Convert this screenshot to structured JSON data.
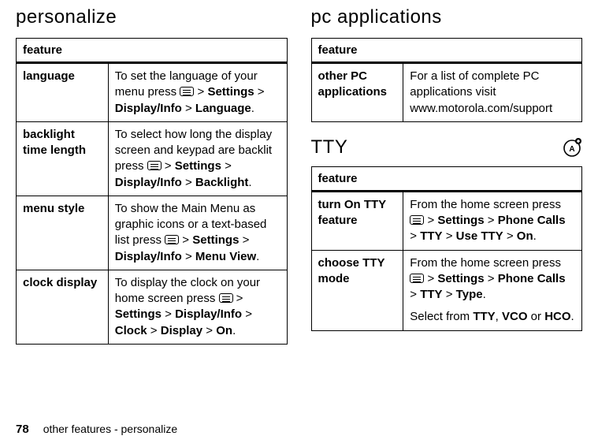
{
  "left": {
    "heading": "personalize",
    "table_header": "feature",
    "rows": [
      {
        "label": "language",
        "pre": "To set the language of your menu press ",
        "path": [
          "Settings",
          "Display/Info",
          "Language"
        ],
        "tail": "."
      },
      {
        "label": "backlight time length",
        "pre": "To select how long the display screen and keypad are backlit press ",
        "path": [
          "Settings",
          "Display/Info",
          "Backlight"
        ],
        "tail": "."
      },
      {
        "label": "menu style",
        "pre": "To show the Main Menu as graphic icons or a text-based list press ",
        "path": [
          "Settings",
          "Display/Info",
          "Menu View"
        ],
        "tail": "."
      },
      {
        "label": "clock display",
        "pre": "To display the clock on your home screen press ",
        "path": [
          "Settings",
          "Display/Info",
          "Clock",
          "Display",
          "On"
        ],
        "tail": "."
      }
    ]
  },
  "right_pc": {
    "heading": "pc applications",
    "table_header": "feature",
    "rows": [
      {
        "label": "other PC applications",
        "text": "For a list of complete PC applications visit www.motorola.com/support"
      }
    ]
  },
  "right_tty": {
    "heading": "TTY",
    "table_header": "feature",
    "rows": [
      {
        "label": "turn On TTY feature",
        "pre": "From the home screen press ",
        "path": [
          "Settings",
          "Phone Calls",
          "TTY",
          "Use TTY",
          "On"
        ],
        "tail": "."
      },
      {
        "label": "choose TTY mode",
        "pre": "From the home screen press ",
        "path": [
          "Settings",
          "Phone Calls",
          "TTY",
          "Type"
        ],
        "tail": ".",
        "extra_pre": "Select from ",
        "extra_opts": [
          "TTY",
          "VCO",
          "HCO"
        ],
        "extra_tail": "."
      }
    ]
  },
  "footer": {
    "page": "78",
    "text": "other features - personalize"
  },
  "sep": " > ",
  "or": " or "
}
